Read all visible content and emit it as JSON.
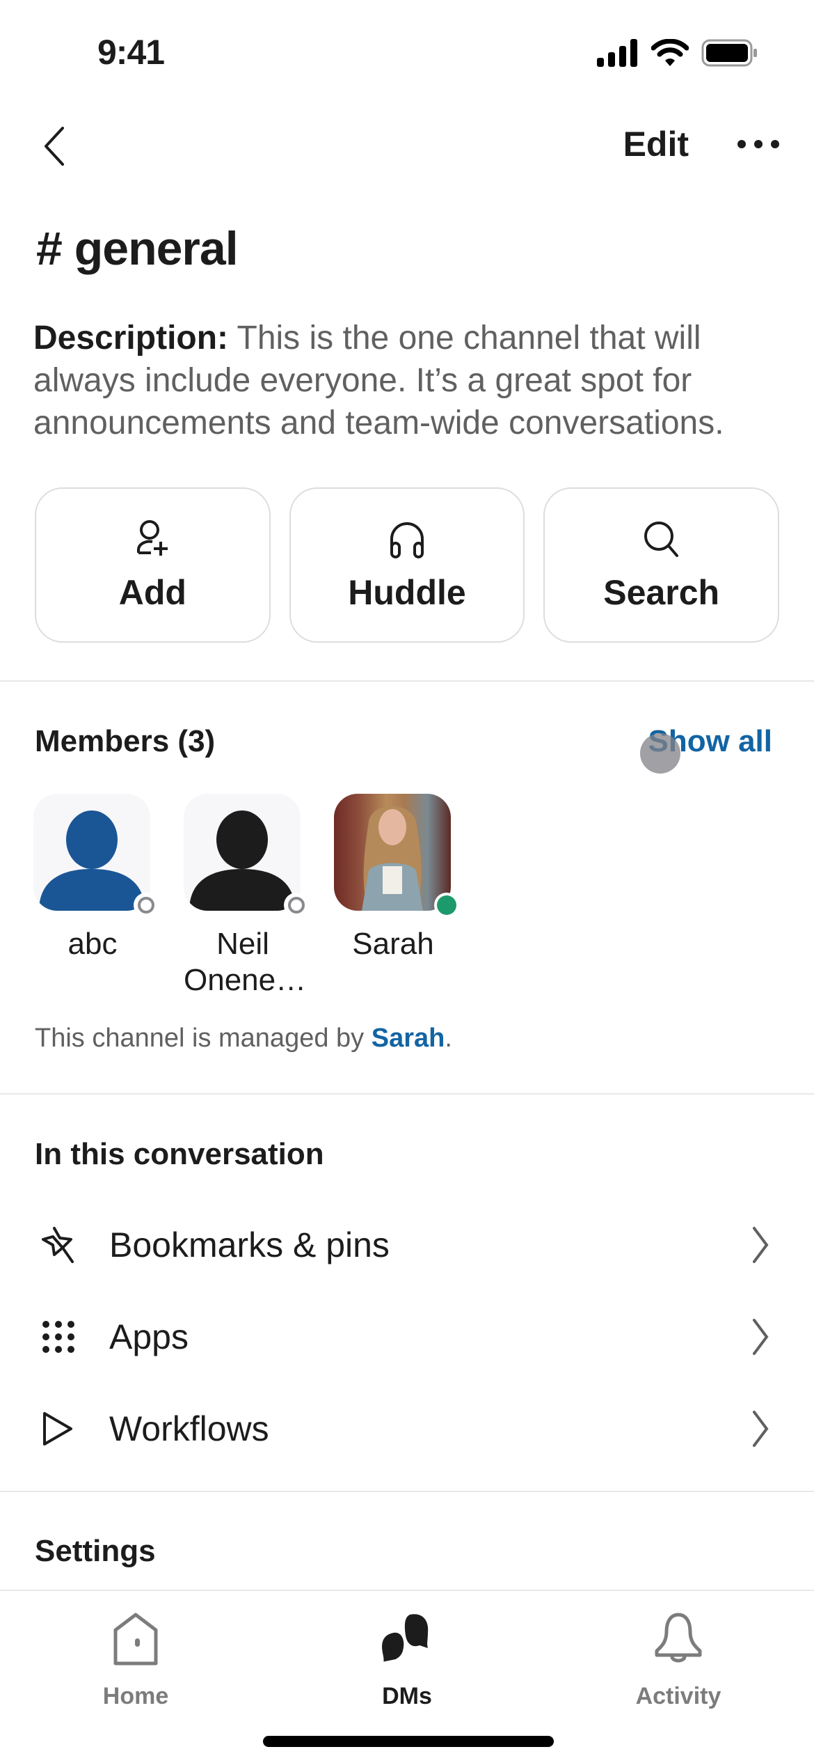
{
  "status_bar": {
    "time": "9:41"
  },
  "nav": {
    "back_icon": "chevron-left-icon",
    "edit_label": "Edit",
    "more_icon": "ellipsis-icon"
  },
  "channel": {
    "title": "# general",
    "description_label": "Description:",
    "description_text": " This is the one channel that will always include everyone. It’s a great spot for announcements and team-wide conversations."
  },
  "actions": [
    {
      "label": "Add",
      "icon": "add-person-icon"
    },
    {
      "label": "Huddle",
      "icon": "headphones-icon"
    },
    {
      "label": "Search",
      "icon": "search-icon"
    }
  ],
  "members": {
    "title": "Members (3)",
    "show_all_label": "Show all",
    "list": [
      {
        "name": "abc",
        "presence": "away",
        "avatar_color": "#1a5696"
      },
      {
        "name": "Neil Onene…",
        "presence": "away",
        "avatar_color": "#1d1c1d"
      },
      {
        "name": "Sarah",
        "presence": "active",
        "avatar": "photo"
      }
    ],
    "managed_prefix": "This channel is managed by ",
    "managed_by": "Sarah",
    "managed_suffix": "."
  },
  "conversation": {
    "title": "In this conversation",
    "items": [
      {
        "label": "Bookmarks & pins",
        "icon": "pin-icon"
      },
      {
        "label": "Apps",
        "icon": "apps-grid-icon"
      },
      {
        "label": "Workflows",
        "icon": "play-icon"
      }
    ]
  },
  "settings": {
    "title": "Settings"
  },
  "tabbar": {
    "tabs": [
      {
        "label": "Home",
        "icon": "home-icon",
        "active": false
      },
      {
        "label": "DMs",
        "icon": "dms-icon",
        "active": true
      },
      {
        "label": "Activity",
        "icon": "bell-icon",
        "active": false
      }
    ]
  },
  "colors": {
    "link": "#1264a3",
    "active_presence": "#1d9a6c",
    "text": "#1d1c1d",
    "muted": "#616061"
  }
}
